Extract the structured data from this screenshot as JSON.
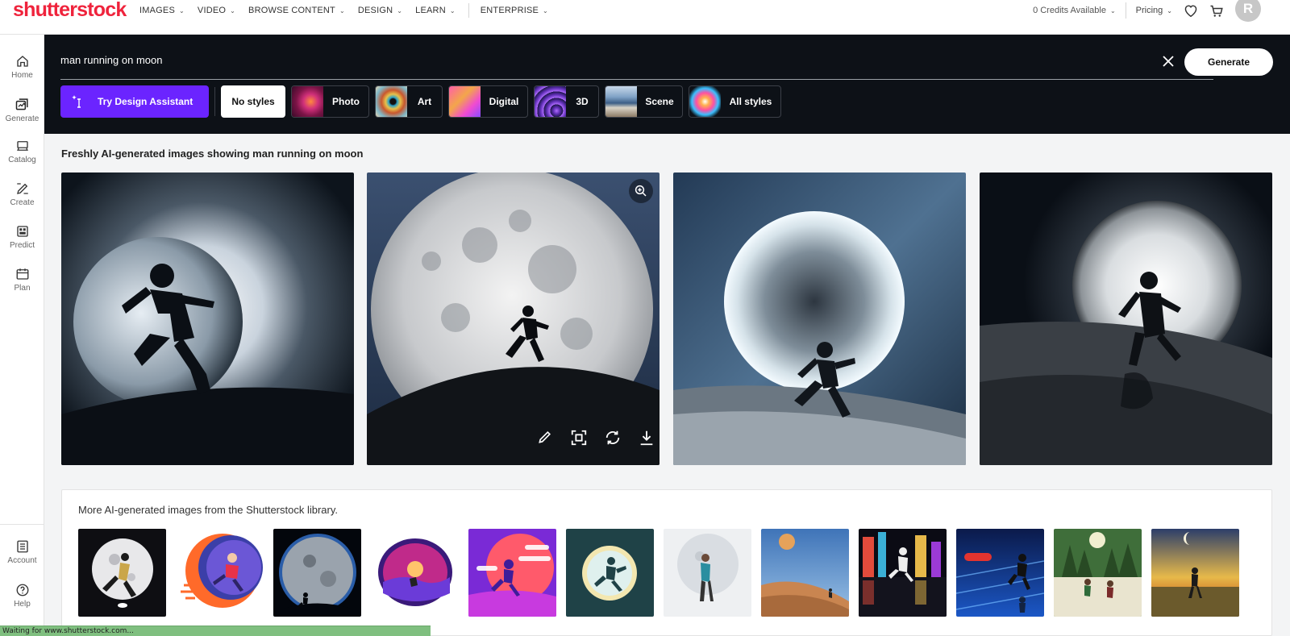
{
  "brand": {
    "logo_text": "shutterstock",
    "accent": "#ef233c"
  },
  "topnav": {
    "items": [
      {
        "label": "IMAGES"
      },
      {
        "label": "VIDEO"
      },
      {
        "label": "BROWSE CONTENT"
      },
      {
        "label": "DESIGN"
      },
      {
        "label": "LEARN"
      },
      {
        "label": "ENTERPRISE"
      }
    ],
    "credits": "0 Credits Available",
    "pricing": "Pricing",
    "avatar_initial": "R"
  },
  "sidebar": {
    "items": [
      {
        "label": "Home",
        "icon": "home-icon"
      },
      {
        "label": "Generate",
        "icon": "generate-icon"
      },
      {
        "label": "Catalog",
        "icon": "catalog-icon"
      },
      {
        "label": "Create",
        "icon": "create-icon"
      },
      {
        "label": "Predict",
        "icon": "predict-icon"
      },
      {
        "label": "Plan",
        "icon": "plan-icon"
      }
    ],
    "bottom": [
      {
        "label": "Account",
        "icon": "account-icon"
      },
      {
        "label": "Help",
        "icon": "help-icon"
      }
    ]
  },
  "generate": {
    "query": "man running on moon",
    "button_label": "Generate",
    "assistant_label": "Try Design Assistant",
    "assistant_color": "#6b24ff",
    "styles": [
      {
        "label": "No styles",
        "selected": true
      },
      {
        "label": "Photo"
      },
      {
        "label": "Art"
      },
      {
        "label": "Digital"
      },
      {
        "label": "3D"
      },
      {
        "label": "Scene"
      },
      {
        "label": "All styles"
      }
    ]
  },
  "results": {
    "heading": "Freshly AI-generated images showing man running on moon",
    "images": [
      {
        "alt": "silhouette running in front of glowing planet"
      },
      {
        "alt": "silhouette running on hill before full moon"
      },
      {
        "alt": "man running on rocky surface before large moon"
      },
      {
        "alt": "shadowy figure running on rocky slope with moon"
      }
    ]
  },
  "library": {
    "heading": "More AI-generated images from the Shutterstock library.",
    "thumbs": 12
  },
  "statusbar": {
    "text": "Waiting for www.shutterstock.com..."
  }
}
